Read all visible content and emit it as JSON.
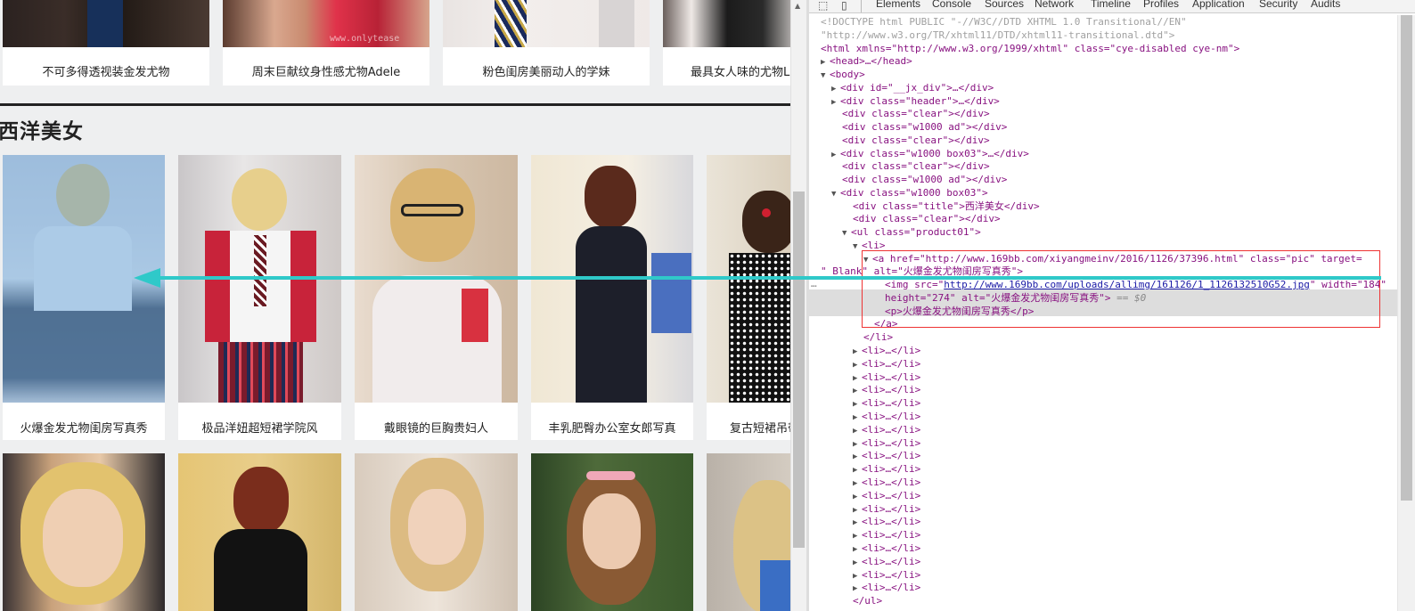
{
  "top_row": [
    {
      "caption": "不可多得透视装金发尤物"
    },
    {
      "caption": "周末巨献纹身性感尤物Adele",
      "watermark": "www.onlytease"
    },
    {
      "caption": "粉色闺房美丽动人的学妹"
    },
    {
      "caption": "最具女人味的尤物Laura"
    }
  ],
  "section_title": "西洋美女",
  "row1": [
    {
      "caption": "火爆金发尤物闺房写真秀"
    },
    {
      "caption": "极品洋妞超短裙学院风"
    },
    {
      "caption": "戴眼镜的巨胸贵妇人"
    },
    {
      "caption": "丰乳肥臀办公室女郎写真"
    },
    {
      "caption": "复古短裙吊带"
    }
  ],
  "devtools": {
    "tabs": [
      "Elements",
      "Console",
      "Sources",
      "Network",
      "Timeline",
      "Profiles",
      "Application",
      "Security",
      "Audits"
    ],
    "doctype_1": "<!DOCTYPE html PUBLIC \"-//W3C//DTD XHTML 1.0 Transitional//EN\"",
    "doctype_2": "\"http://www.w3.org/TR/xhtml11/DTD/xhtml11-transitional.dtd\">",
    "html_open": "<html xmlns=\"http://www.w3.org/1999/xhtml\" class=\"cye-disabled cye-nm\">",
    "head": "<head>…</head>",
    "body_open": "<body>",
    "jx_div": "<div id=\"__jx_div\">…</div>",
    "header_div": "<div class=\"header\">…</div>",
    "clear1": "<div class=\"clear\"></div>",
    "ad1": "<div class=\"w1000 ad\"></div>",
    "clear2": "<div class=\"clear\"></div>",
    "box03a": "<div class=\"w1000 box03\">…</div>",
    "clear3": "<div class=\"clear\"></div>",
    "ad2": "<div class=\"w1000 ad\"></div>",
    "box03b": "<div class=\"w1000 box03\">",
    "title_div": "<div class=\"title\">西洋美女</div>",
    "clear4": "<div class=\"clear\"></div>",
    "ul_open": "<ul class=\"product01\">",
    "li_open": "<li>",
    "a_open_1": "<a href=\"http://www.169bb.com/xiyangmeinv/2016/1126/37396.html\" class=\"pic\" target=",
    "a_open_2": "\"_Blank\" alt=\"火爆金发尤物闺房写真秀\">",
    "img_1_pre": "<img src=\"",
    "img_src": "http://www.169bb.com/uploads/allimg/161126/1_1126132510G52.jpg",
    "img_1_post": "\" width=\"184\"",
    "img_2": "height=\"274\" alt=\"火爆金发尤物闺房写真秀\">",
    "img_eq": " == $0",
    "p_line": "<p>火爆金发尤物闺房写真秀</p>",
    "a_close": "</a>",
    "li_close": "</li>",
    "li_collapsed": "<li>…</li>",
    "ul_close": "</ul>"
  }
}
